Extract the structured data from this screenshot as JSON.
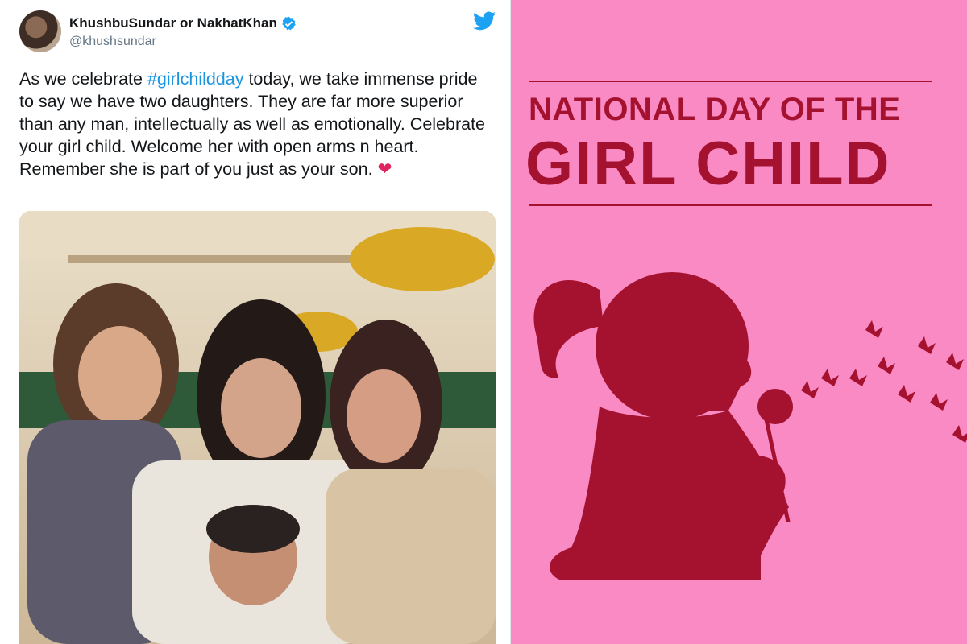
{
  "tweet": {
    "author_name": "KhushbuSundar or NakhatKhan",
    "handle": "@khushsundar",
    "text_before": "As we celebrate ",
    "hashtag": "#girlchildday",
    "text_after": " today, we take immense pride to say we have two daughters. They are far more superior than any man, intellectually as well as emotionally. Celebrate your girl child. Welcome her with open arms n heart. Remember she is part of you just as your son. ",
    "heart": "❤"
  },
  "poster": {
    "title_line1": "NATIONAL DAY OF THE",
    "title_line2": "GIRL CHILD"
  },
  "colors": {
    "poster_bg": "#f98ac4",
    "poster_accent": "#a4122f",
    "hashtag": "#1b95e0",
    "verified": "#1da1f2"
  }
}
